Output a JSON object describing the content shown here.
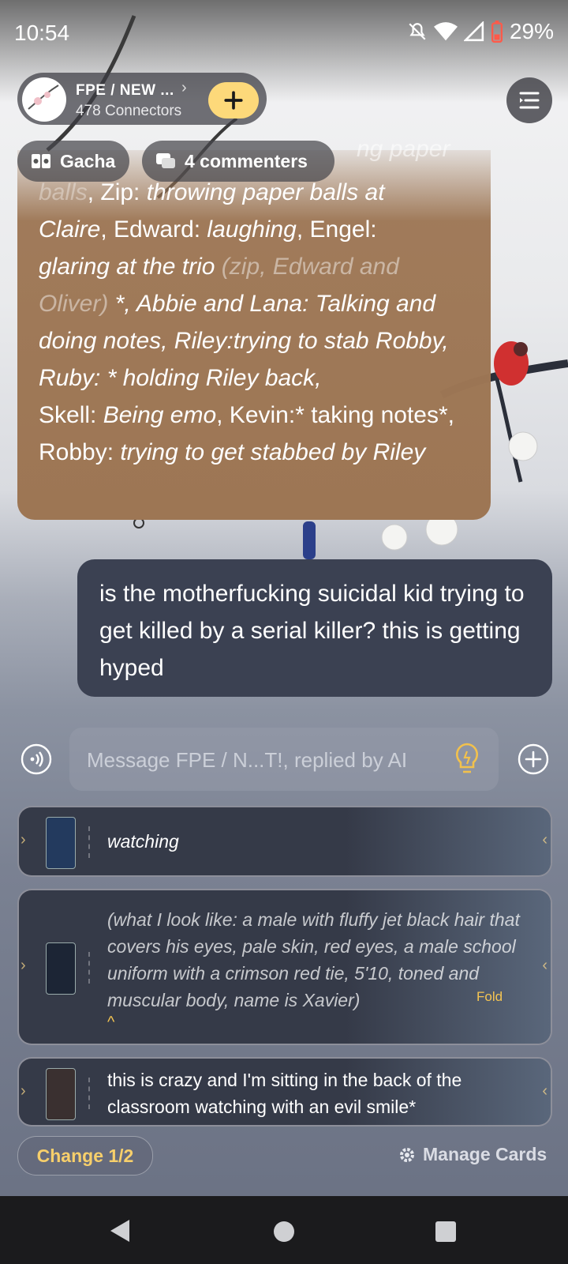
{
  "status_bar": {
    "time": "10:54",
    "battery": "29%"
  },
  "group": {
    "name": "FPE / NEW ...",
    "connectors": "478 Connectors"
  },
  "chips": {
    "gacha": "Gacha",
    "commenters": "4 commenters"
  },
  "ai_message": {
    "line_faded_top": "ng paper",
    "seg1": "balls",
    "seg2": ", Zip: ",
    "seg3": "throwing paper balls at",
    "seg4": "Claire",
    "seg5": ", Edward: ",
    "seg6": "laughing",
    "seg7": ", Engel:",
    "seg8": "glaring at the trio ",
    "seg9": "(zip, Edward and Oliver)",
    "seg10": " *, Abbie and Lana: Talking and doing notes,  Riley:trying to stab Robby, Ruby: * holding Riley back,",
    "seg11": "Skell: ",
    "seg12": "Being emo",
    "seg13": ", Kevin:* taking notes*, Robby: ",
    "seg14": "trying to get stabbed by Riley"
  },
  "user_message": {
    "text": "is the motherfucking suicidal kid trying to get killed by a serial killer? this is getting hyped"
  },
  "input": {
    "placeholder": "Message FPE / N...T!, replied by AI"
  },
  "cards": [
    {
      "text": "watching"
    },
    {
      "text": "(what I look like: a male with fluffy jet black hair that covers his eyes, pale skin, red eyes, a male school uniform with a crimson red tie, 5'10, toned and muscular body, name is Xavier)",
      "fold_label": "Fold"
    },
    {
      "text": "this is crazy and I'm sitting in the back of the classroom watching with an evil smile*"
    }
  ],
  "actions": {
    "change": "Change 1/2",
    "manage": "Manage Cards"
  },
  "colors": {
    "accent_yellow": "#fdd97a",
    "ai_bubble": "#9d7654",
    "user_bubble": "#3b4152"
  }
}
